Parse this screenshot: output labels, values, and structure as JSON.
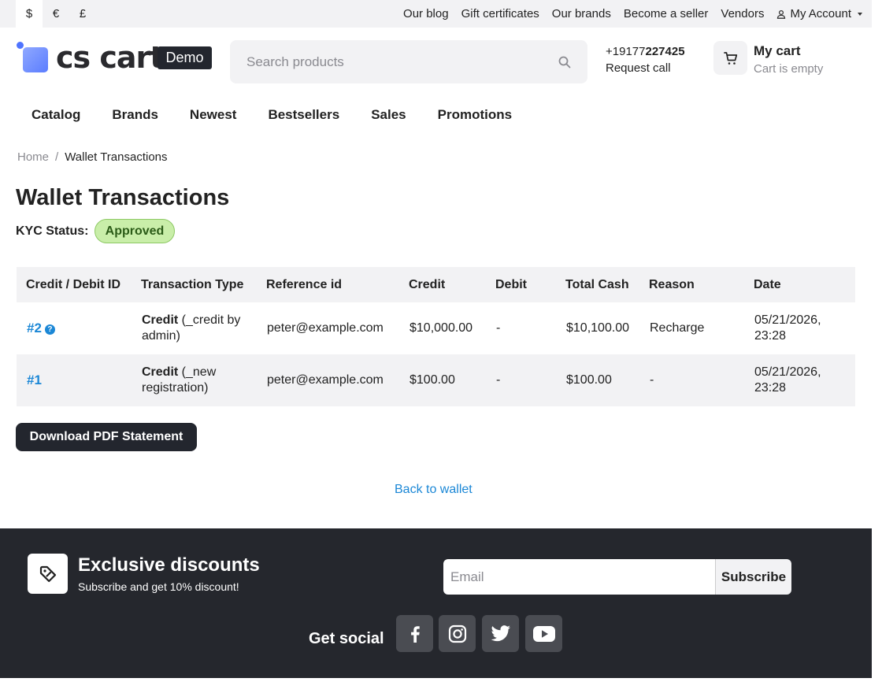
{
  "currency": {
    "items": [
      "$",
      "€",
      "£"
    ],
    "selected": "$"
  },
  "top_links": [
    "Our blog",
    "Gift certificates",
    "Our brands",
    "Become a seller",
    "Vendors"
  ],
  "account": {
    "label": "My Account"
  },
  "logo": {
    "text": "cs cart",
    "badge": "Demo"
  },
  "search": {
    "placeholder": "Search products"
  },
  "contact": {
    "phone_prefix": "+19177",
    "phone_bold": "227425",
    "request_call": "Request call"
  },
  "cart": {
    "title": "My cart",
    "status": "Cart is empty"
  },
  "nav": [
    "Catalog",
    "Brands",
    "Newest",
    "Bestsellers",
    "Sales",
    "Promotions"
  ],
  "breadcrumb": {
    "home": "Home",
    "separator": "/",
    "current": "Wallet Transactions"
  },
  "page_title": "Wallet Transactions",
  "kyc": {
    "label": "KYC Status:",
    "status": "Approved",
    "status_color": "#c9eea9"
  },
  "table": {
    "headers": [
      "Credit / Debit ID",
      "Transaction Type",
      "Reference id",
      "Credit",
      "Debit",
      "Total Cash",
      "Reason",
      "Date"
    ],
    "rows": [
      {
        "id": "#2",
        "type_bold": "Credit",
        "type_rest": " (_credit by admin)",
        "reference": "peter@example.com",
        "credit": "$10,000.00",
        "debit": "-",
        "total": "$10,100.00",
        "reason": "Recharge",
        "date": "05/21/2026, 23:28"
      },
      {
        "id": "#1",
        "type_bold": "Credit",
        "type_rest": " (_new registration)",
        "reference": "peter@example.com",
        "credit": "$100.00",
        "debit": "-",
        "total": "$100.00",
        "reason": "-",
        "date": "05/21/2026, 23:28"
      }
    ]
  },
  "download_button": "Download PDF Statement",
  "back_link": "Back to wallet",
  "footer": {
    "discount_title": "Exclusive discounts",
    "discount_sub": "Subscribe and get 10% discount!",
    "email_placeholder": "Email",
    "subscribe_label": "Subscribe",
    "social_label": "Get social",
    "social_icons": [
      "facebook-icon",
      "instagram-icon",
      "twitter-icon",
      "youtube-icon"
    ]
  },
  "colors": {
    "accent": "#1b87d6",
    "dark": "#23262e",
    "footer_bg": "#25272d",
    "light_bg": "#f2f2f4"
  }
}
